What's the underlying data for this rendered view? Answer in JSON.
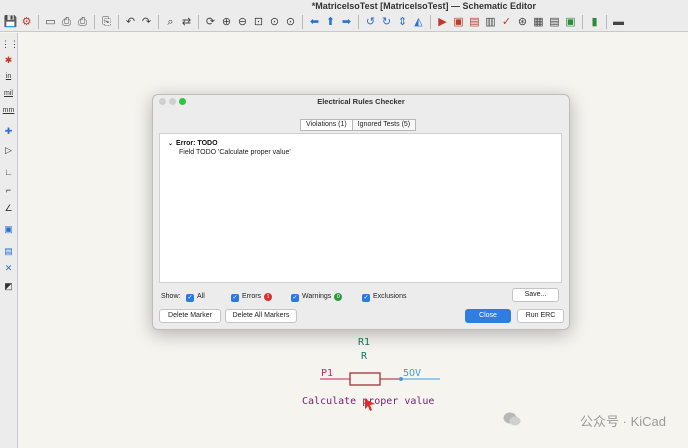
{
  "window": {
    "title": "*MatriceIsoTest [MatriceIsoTest] — Schematic Editor"
  },
  "left_toolbar": {
    "units": [
      "in",
      "mil",
      "mm"
    ]
  },
  "dialog": {
    "title": "Electrical Rules Checker",
    "tabs": [
      {
        "label": "Violations (1)",
        "active": true
      },
      {
        "label": "Ignored Tests (5)",
        "active": false
      }
    ],
    "violations": [
      {
        "heading": "Error: TODO",
        "detail": "Field TODO 'Calculate proper value'"
      }
    ],
    "filters": {
      "show_label": "Show:",
      "all": {
        "label": "All",
        "checked": true
      },
      "errors": {
        "label": "Errors",
        "count": "1",
        "checked": true
      },
      "warnings": {
        "label": "Warnings",
        "count": "0",
        "checked": true
      },
      "exclusions": {
        "label": "Exclusions",
        "checked": true
      }
    },
    "buttons": {
      "save": "Save...",
      "delete_marker": "Delete Marker",
      "delete_all": "Delete All Markers",
      "close": "Close",
      "run": "Run ERC"
    }
  },
  "schematic": {
    "ref": "R1",
    "value": "R",
    "net_left": "P1",
    "net_right": "5OV",
    "field_text": "Calculate proper value"
  },
  "watermark": {
    "text": "公众号 · KiCad"
  },
  "colors": {
    "accent": "#2f7de1",
    "error": "#e02b2b",
    "ok": "#2c9a3a",
    "wire": "#c8245b",
    "net": "#3aa0d8",
    "field": "#7a1f74"
  }
}
